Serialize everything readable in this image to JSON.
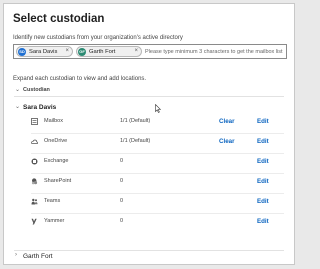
{
  "dialog": {
    "title": "Select custodian",
    "subtitle": "Identify new custodians from your organization's active directory"
  },
  "picker": {
    "chips": [
      {
        "initials": "SD",
        "name": "Sara Davis",
        "avatar_color": "#1f6fd1"
      },
      {
        "initials": "GF",
        "name": "Garth Fort",
        "avatar_color": "#2b8a72"
      }
    ],
    "remove_glyph": "×",
    "placeholder": "Please type minimum 3 characters to get the mailbox list"
  },
  "instruction": "Expand each custodian to view and add locations.",
  "table": {
    "column_label": "Custodian"
  },
  "custodians": [
    {
      "name": "Sara Davis",
      "expanded": true,
      "locations": [
        {
          "name": "Mailbox",
          "count": "1/1 (Default)",
          "clear": "Clear",
          "edit": "Edit",
          "icon": "mailbox-icon"
        },
        {
          "name": "OneDrive",
          "count": "1/1 (Default)",
          "clear": "Clear",
          "edit": "Edit",
          "icon": "onedrive-icon"
        },
        {
          "name": "Exchange",
          "count": "0",
          "edit": "Edit",
          "icon": "exchange-icon"
        },
        {
          "name": "SharePoint",
          "count": "0",
          "edit": "Edit",
          "icon": "sharepoint-icon"
        },
        {
          "name": "Teams",
          "count": "0",
          "edit": "Edit",
          "icon": "teams-icon"
        },
        {
          "name": "Yammer",
          "count": "0",
          "edit": "Edit",
          "icon": "yammer-icon"
        }
      ]
    },
    {
      "name": "Garth Fort",
      "expanded": false
    }
  ],
  "colors": {
    "link": "#0a64c0",
    "border": "#c8c8c8"
  }
}
